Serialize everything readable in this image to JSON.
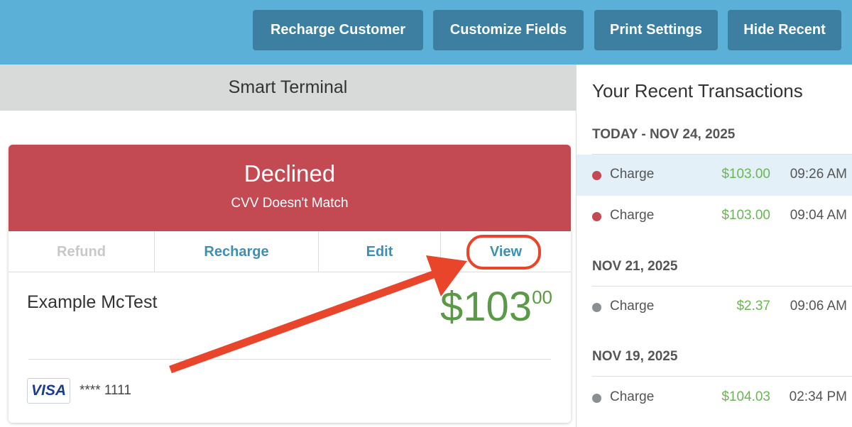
{
  "toolbar": {
    "recharge_customer": "Recharge Customer",
    "customize_fields": "Customize Fields",
    "print_settings": "Print Settings",
    "hide_recent": "Hide Recent"
  },
  "terminal": {
    "title": "Smart Terminal",
    "card": {
      "status": "Declined",
      "reason": "CVV Doesn't Match",
      "actions": {
        "refund": "Refund",
        "recharge": "Recharge",
        "edit": "Edit",
        "view": "View"
      },
      "customer_name": "Example McTest",
      "amount_dollars": "$103",
      "amount_cents": "00",
      "card_brand": "VISA",
      "card_mask": "**** 1111"
    }
  },
  "recent": {
    "title": "Your Recent Transactions",
    "groups": [
      {
        "date": "TODAY - NOV 24, 2025",
        "items": [
          {
            "type": "Charge",
            "amount": "$103.00",
            "time": "09:26 AM",
            "status_color": "#c34a53"
          },
          {
            "type": "Charge",
            "amount": "$103.00",
            "time": "09:04 AM",
            "status_color": "#c34a53"
          }
        ]
      },
      {
        "date": "NOV 21, 2025",
        "items": [
          {
            "type": "Charge",
            "amount": "$2.37",
            "time": "09:06 AM",
            "status_color": "#8a8f94"
          }
        ]
      },
      {
        "date": "NOV 19, 2025",
        "items": [
          {
            "type": "Charge",
            "amount": "$104.03",
            "time": "02:34 PM",
            "status_color": "#8a8f94"
          }
        ]
      }
    ]
  },
  "colors": {
    "header_blue": "#5bb0d8",
    "button_blue": "#3c7fa1",
    "declined_red": "#c34a53",
    "amount_green": "#5a9a46",
    "annotation_red": "#e8452a"
  }
}
